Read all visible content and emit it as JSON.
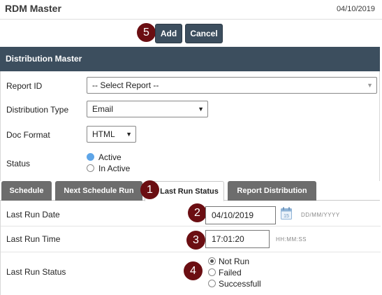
{
  "header": {
    "title": "RDM Master",
    "date": "04/10/2019"
  },
  "actions": {
    "add_label": "Add",
    "cancel_label": "Cancel"
  },
  "markers": {
    "m1": "1",
    "m2": "2",
    "m3": "3",
    "m4": "4",
    "m5": "5"
  },
  "panel": {
    "title": "Distribution Master",
    "report_id": {
      "label": "Report ID",
      "value": "-- Select Report --"
    },
    "distribution_type": {
      "label": "Distribution Type",
      "value": "Email"
    },
    "doc_format": {
      "label": "Doc Format",
      "value": "HTML"
    },
    "status": {
      "label": "Status",
      "options": [
        {
          "label": "Active",
          "checked": true
        },
        {
          "label": "In Active",
          "checked": false
        }
      ]
    }
  },
  "tabs": [
    {
      "label": "Schedule",
      "active": false
    },
    {
      "label": "Next Schedule Run",
      "active": false
    },
    {
      "label": "Last Run Status",
      "active": true
    },
    {
      "label": "Report Distribution",
      "active": false
    }
  ],
  "last_run": {
    "date": {
      "label": "Last Run Date",
      "value": "04/10/2019",
      "hint": "DD/MM/YYYY"
    },
    "time": {
      "label": "Last Run Time",
      "value": "17:01:20",
      "hint": "HH:MM:SS"
    },
    "status": {
      "label": "Last Run Status",
      "options": [
        {
          "label": "Not Run",
          "checked": true
        },
        {
          "label": "Failed",
          "checked": false
        },
        {
          "label": "Successfull",
          "checked": false
        }
      ]
    }
  },
  "calendar_icon": {
    "day": "15"
  },
  "colors": {
    "header_bg": "#3c4e5e",
    "tab_bg": "#6d6d6d",
    "marker": "#6b0e12",
    "radio_active": "#5ea5e8"
  }
}
